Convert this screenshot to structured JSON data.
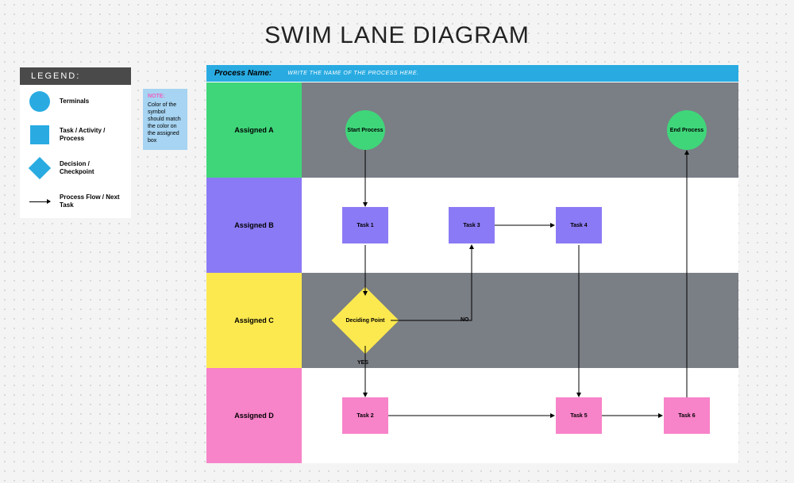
{
  "title": "SWIM LANE DIAGRAM",
  "legend": {
    "header": "LEGEND:",
    "items": [
      {
        "label": "Terminals"
      },
      {
        "label": "Task / Activity / Process"
      },
      {
        "label": "Decision / Checkpoint"
      },
      {
        "label": "Process Flow / Next Task"
      }
    ]
  },
  "note": {
    "title": "NOTE:",
    "text": "Color of the symbol should match the color on the assigned box"
  },
  "processBar": {
    "label": "Process Name:",
    "placeholder": "WRITE THE NAME OF THE PROCESS HERE."
  },
  "lanes": {
    "a": "Assigned A",
    "b": "Assigned B",
    "c": "Assigned C",
    "d": "Assigned D"
  },
  "shapes": {
    "start": "Start Process",
    "end": "End Process",
    "task1": "Task 1",
    "task2": "Task 2",
    "task3": "Task 3",
    "task4": "Task 4",
    "task5": "Task 5",
    "task6": "Task 6",
    "decision": "Deciding Point",
    "yes": "YES",
    "no": "NO"
  },
  "colors": {
    "green": "#3fd67a",
    "purple": "#8b7af5",
    "yellow": "#fce94f",
    "pink": "#f783c9",
    "blue": "#29abe2",
    "gray": "#7a7e85"
  }
}
